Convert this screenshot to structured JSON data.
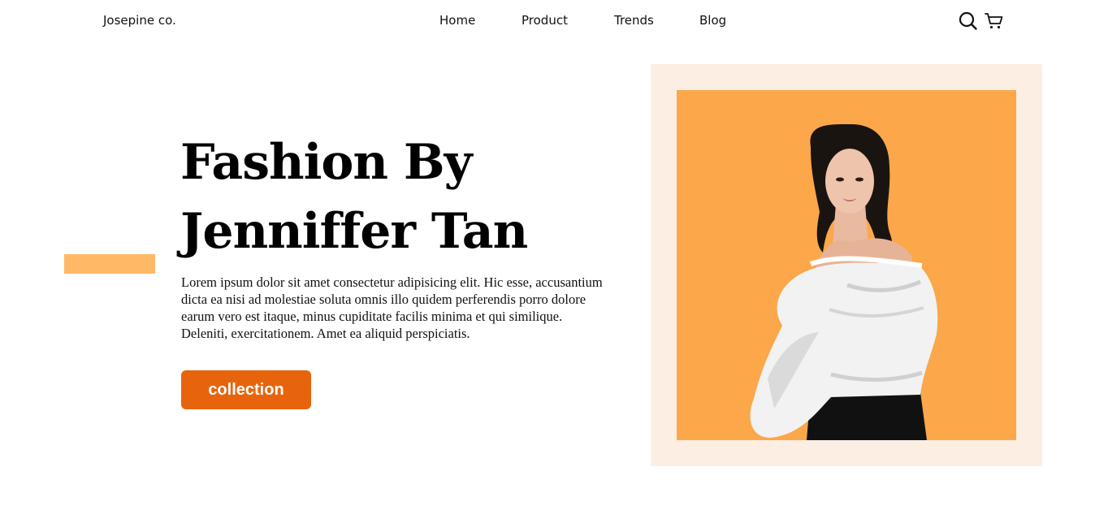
{
  "header": {
    "brand": "Josepine co.",
    "nav": [
      "Home",
      "Product",
      "Trends",
      "Blog"
    ],
    "icons": [
      "search-icon",
      "cart-icon"
    ]
  },
  "hero": {
    "title_line1": "Fashion By",
    "title_line2": "Jenniffer Tan",
    "description": "Lorem ipsum dolor sit amet consectetur adipisicing elit. Hic esse, accusantium dicta ea nisi ad molestiae soluta omnis illo quidem perferendis porro dolore earum vero est itaque, minus cupiditate facilis minima et qui similique. Deleniti, exercitationem. Amet ea aliquid perspiciatis.",
    "cta_label": "collection"
  },
  "colors": {
    "accent_bar": "#FFB966",
    "cta": "#E8640C",
    "frame": "#FCEEE3",
    "photo_bg": "#FBA74A"
  }
}
